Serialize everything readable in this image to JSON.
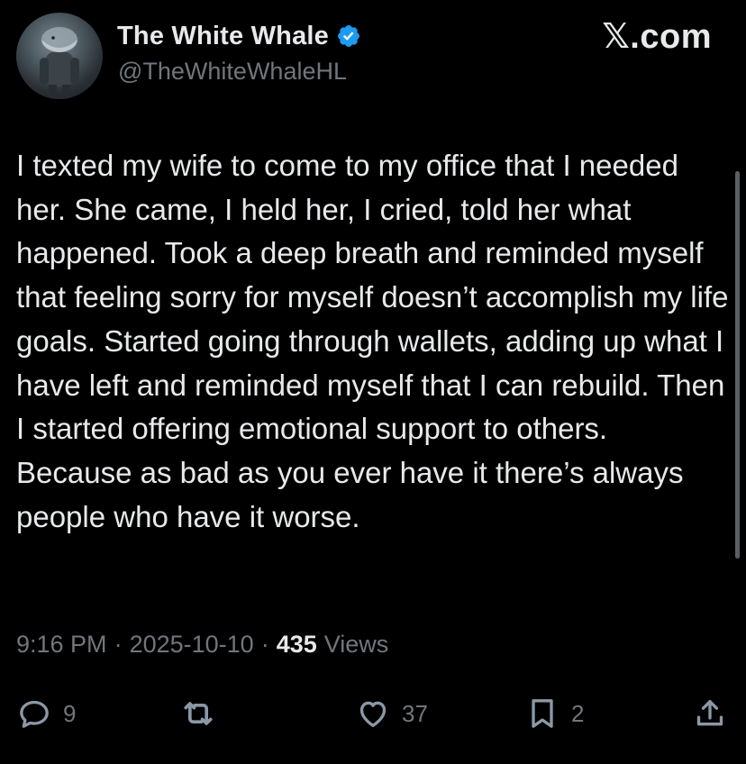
{
  "author": {
    "display_name": "The White Whale",
    "handle": "@TheWhiteWhaleHL",
    "verified": true,
    "avatar_icon": "avatar-icon",
    "verified_color": "#1d9bf0"
  },
  "brand": "𝕏.com",
  "tweet": {
    "text": "I texted my wife to come to my office that I needed her. She came, I held her, I cried, told her what happened. Took a deep breath and reminded myself that feeling sorry for myself doesn’t accomplish my life goals. Started going through wallets, adding up what I have left and reminded myself that I can rebuild. Then I started offering emotional support to others. Because as bad as you ever have it there’s always people who have it worse.",
    "time": "9:16 PM",
    "date": "2025-10-10",
    "views_count": "435",
    "views_label": "Views",
    "separator": "·"
  },
  "actions": {
    "reply_count": "9",
    "retweet_count": "",
    "like_count": "37",
    "bookmark_count": "2"
  },
  "colors": {
    "background": "#000000",
    "text": "#e7e9ea",
    "muted": "#71767b"
  }
}
